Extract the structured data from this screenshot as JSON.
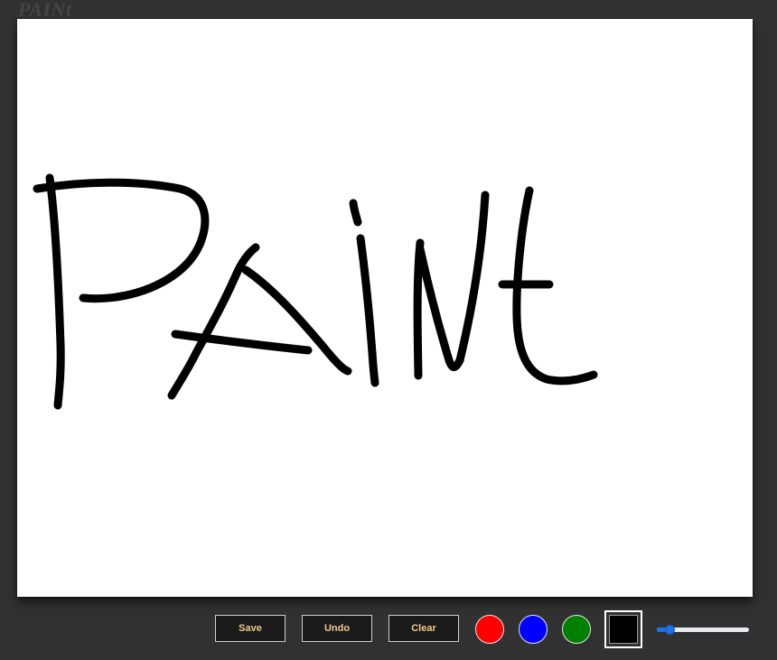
{
  "app": {
    "title": "PAINt"
  },
  "toolbar": {
    "save_label": "Save",
    "undo_label": "Undo",
    "clear_label": "Clear",
    "colors": [
      {
        "name": "red",
        "hex": "#ff0000"
      },
      {
        "name": "blue",
        "hex": "#0000ff"
      },
      {
        "name": "green",
        "hex": "#008000"
      }
    ],
    "active_color": {
      "name": "black",
      "hex": "#000000"
    },
    "brush_size": {
      "fraction": 0.1
    }
  },
  "drawing": {
    "stroke_color": "#000000",
    "depicted_text": "PAINt"
  }
}
